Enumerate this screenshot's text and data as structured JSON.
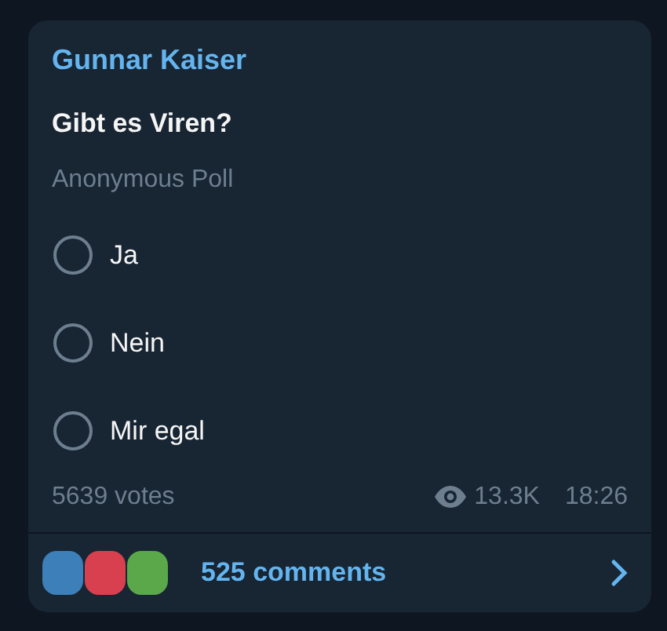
{
  "message": {
    "author": "Gunnar Kaiser",
    "question": "Gibt es Viren?",
    "poll_type": "Anonymous Poll",
    "options": [
      {
        "label": "Ja",
        "selected": false
      },
      {
        "label": "Nein",
        "selected": false
      },
      {
        "label": "Mir egal",
        "selected": false
      }
    ],
    "votes": "5639 votes",
    "views": "13.3K",
    "time": "18:26"
  },
  "comments": {
    "avatars": [
      {
        "color": "#3d7fb8"
      },
      {
        "color": "#d9404f"
      },
      {
        "color": "#5aa84a"
      }
    ],
    "label": "525 comments"
  }
}
